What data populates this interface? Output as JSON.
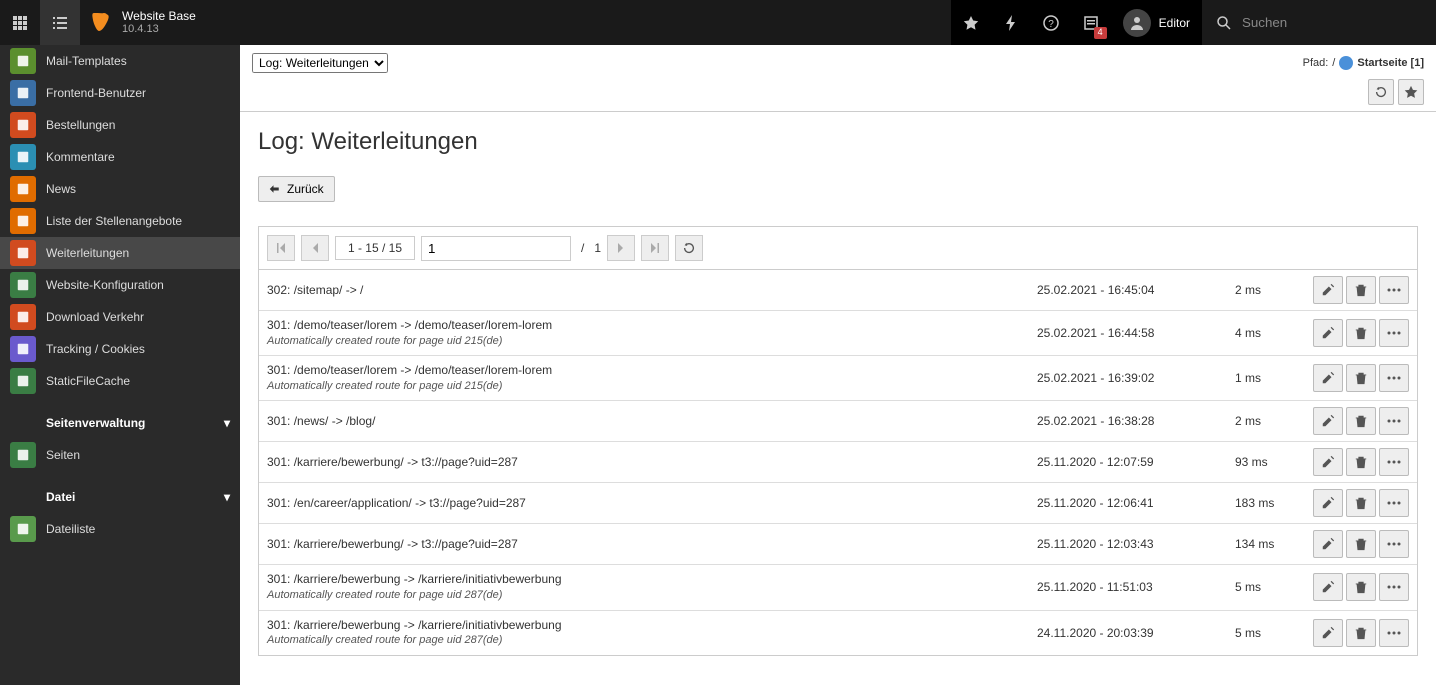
{
  "top": {
    "site_name": "Website Base",
    "version": "10.4.13",
    "badge": "4",
    "user_label": "Editor",
    "search_placeholder": "Suchen"
  },
  "sidebar": {
    "items": [
      {
        "key": "mail-templates",
        "label": "Mail-Templates",
        "bg": "#5b8f2e"
      },
      {
        "key": "fe-users",
        "label": "Frontend-Benutzer",
        "bg": "#3a6ea5"
      },
      {
        "key": "orders",
        "label": "Bestellungen",
        "bg": "#d14b1f"
      },
      {
        "key": "comments",
        "label": "Kommentare",
        "bg": "#2b8fb3"
      },
      {
        "key": "news",
        "label": "News",
        "bg": "#e06c00"
      },
      {
        "key": "jobs",
        "label": "Liste der Stellenangebote",
        "bg": "#e06c00"
      },
      {
        "key": "redirects",
        "label": "Weiterleitungen",
        "bg": "#d14b1f",
        "active": true
      },
      {
        "key": "webconfig",
        "label": "Website-Konfiguration",
        "bg": "#3a7d44"
      },
      {
        "key": "download",
        "label": "Download Verkehr",
        "bg": "#d14b1f"
      },
      {
        "key": "tracking",
        "label": "Tracking / Cookies",
        "bg": "#6a5acd"
      },
      {
        "key": "sfc",
        "label": "StaticFileCache",
        "bg": "#3a7d44"
      }
    ],
    "section_site": "Seitenverwaltung",
    "site_items": [
      {
        "key": "pages",
        "label": "Seiten",
        "bg": "#3a7d44"
      }
    ],
    "section_file": "Datei",
    "file_items": [
      {
        "key": "filelist",
        "label": "Dateiliste",
        "bg": "#599a4c"
      }
    ]
  },
  "doc": {
    "select_label": "Log: Weiterleitungen",
    "path_prefix": "Pfad:",
    "path_slash": "/",
    "path_page": "Startseite [1]",
    "h1": "Log: Weiterleitungen",
    "back": "Zurück",
    "pager": {
      "range": "1 - 15 / 15",
      "page": "1",
      "total": "1"
    }
  },
  "rows": [
    {
      "title": "302: /sitemap/ -> /",
      "sub": "",
      "date": "25.02.2021 - 16:45:04",
      "ms": "2 ms"
    },
    {
      "title": "301: /demo/teaser/lorem -> /demo/teaser/lorem-lorem",
      "sub": "Automatically created route for page uid 215(de)",
      "date": "25.02.2021 - 16:44:58",
      "ms": "4 ms"
    },
    {
      "title": "301: /demo/teaser/lorem -> /demo/teaser/lorem-lorem",
      "sub": "Automatically created route for page uid 215(de)",
      "date": "25.02.2021 - 16:39:02",
      "ms": "1 ms"
    },
    {
      "title": "301: /news/ -> /blog/",
      "sub": "",
      "date": "25.02.2021 - 16:38:28",
      "ms": "2 ms"
    },
    {
      "title": "301: /karriere/bewerbung/ -> t3://page?uid=287",
      "sub": "",
      "date": "25.11.2020 - 12:07:59",
      "ms": "93 ms"
    },
    {
      "title": "301: /en/career/application/ -> t3://page?uid=287",
      "sub": "",
      "date": "25.11.2020 - 12:06:41",
      "ms": "183 ms"
    },
    {
      "title": "301: /karriere/bewerbung/ -> t3://page?uid=287",
      "sub": "",
      "date": "25.11.2020 - 12:03:43",
      "ms": "134 ms"
    },
    {
      "title": "301: /karriere/bewerbung -> /karriere/initiativbewerbung",
      "sub": "Automatically created route for page uid 287(de)",
      "date": "25.11.2020 - 11:51:03",
      "ms": "5 ms"
    },
    {
      "title": "301: /karriere/bewerbung -> /karriere/initiativbewerbung",
      "sub": "Automatically created route for page uid 287(de)",
      "date": "24.11.2020 - 20:03:39",
      "ms": "5 ms"
    }
  ]
}
